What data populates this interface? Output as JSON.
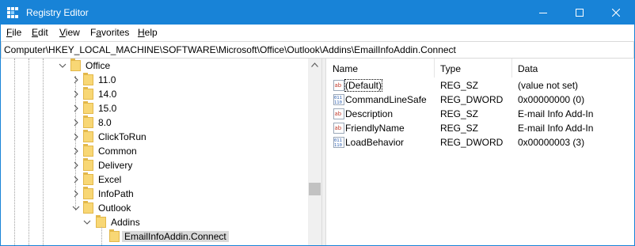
{
  "window": {
    "title": "Registry Editor",
    "app_icon": "registry-editor-icon",
    "controls": [
      "minimize-icon",
      "maximize-icon",
      "close-icon"
    ]
  },
  "menu": [
    {
      "label": "File",
      "underline": "F",
      "rest": "ile"
    },
    {
      "label": "Edit",
      "underline": "E",
      "rest": "dit"
    },
    {
      "label": "View",
      "underline": "V",
      "rest": "iew"
    },
    {
      "label": "Favorites",
      "underline": "a",
      "pre": "F",
      "rest": "vorites"
    },
    {
      "label": "Help",
      "underline": "H",
      "rest": "elp"
    }
  ],
  "address_bar": {
    "path": "Computer\\HKEY_LOCAL_MACHINE\\SOFTWARE\\Microsoft\\Office\\Outlook\\Addins\\EmailInfoAddin.Connect"
  },
  "tree": {
    "items": [
      {
        "label": "Office",
        "expanded": true,
        "depth": 0
      },
      {
        "label": "11.0",
        "expanded": false,
        "depth": 1
      },
      {
        "label": "14.0",
        "expanded": false,
        "depth": 1
      },
      {
        "label": "15.0",
        "expanded": false,
        "depth": 1
      },
      {
        "label": "8.0",
        "expanded": false,
        "depth": 1
      },
      {
        "label": "ClickToRun",
        "expanded": false,
        "depth": 1
      },
      {
        "label": "Common",
        "expanded": false,
        "depth": 1
      },
      {
        "label": "Delivery",
        "expanded": false,
        "depth": 1
      },
      {
        "label": "Excel",
        "expanded": false,
        "depth": 1
      },
      {
        "label": "InfoPath",
        "expanded": false,
        "depth": 1
      },
      {
        "label": "Outlook",
        "expanded": true,
        "depth": 1
      },
      {
        "label": "Addins",
        "expanded": true,
        "depth": 2
      },
      {
        "label": "EmailInfoAddin.Connect",
        "expanded": null,
        "depth": 3,
        "selected": true
      }
    ]
  },
  "values_list": {
    "columns": [
      "Name",
      "Type",
      "Data"
    ],
    "rows": [
      {
        "name": "(Default)",
        "type": "REG_SZ",
        "data": "(value not set)",
        "icon": "string-value-icon",
        "focused": true
      },
      {
        "name": "CommandLineSafe",
        "type": "REG_DWORD",
        "data": "0x00000000 (0)",
        "icon": "binary-value-icon"
      },
      {
        "name": "Description",
        "type": "REG_SZ",
        "data": "E-mail Info Add-In",
        "icon": "string-value-icon"
      },
      {
        "name": "FriendlyName",
        "type": "REG_SZ",
        "data": "E-mail Info Add-In",
        "icon": "string-value-icon"
      },
      {
        "name": "LoadBehavior",
        "type": "REG_DWORD",
        "data": "0x00000003 (3)",
        "icon": "binary-value-icon"
      }
    ]
  },
  "colors": {
    "titlebar": "#1883d7",
    "folder": "#f8d775",
    "selection": "#d9d9d9",
    "string_icon_red": "#c0392b",
    "binary_icon_blue": "#2a5db0"
  }
}
